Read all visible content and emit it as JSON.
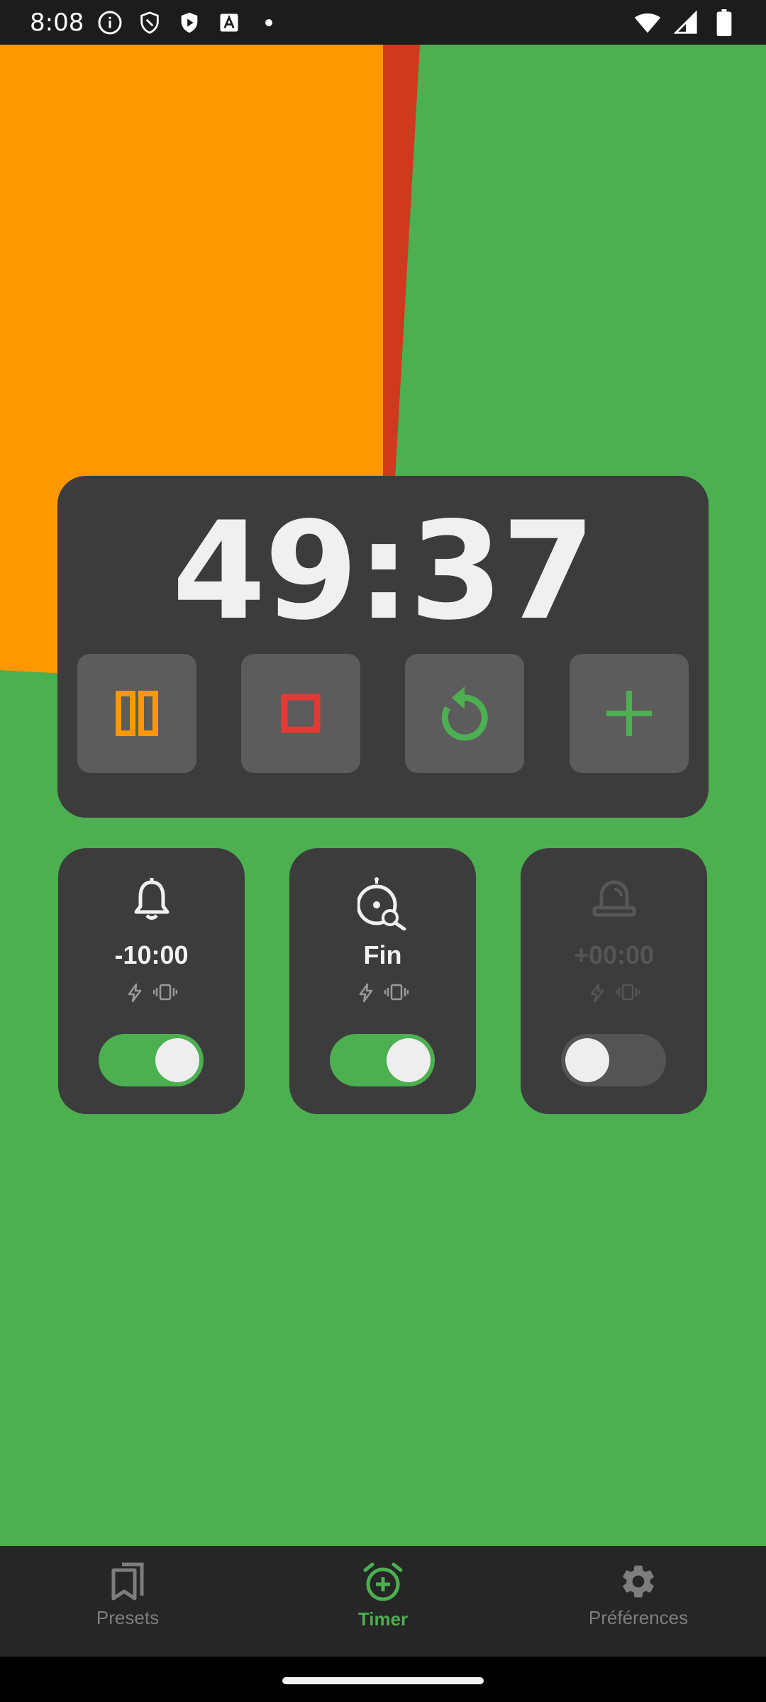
{
  "status_bar": {
    "time": "8:08",
    "icons": [
      "info-icon",
      "shield-icon",
      "play-store-icon",
      "font-icon",
      "dot-icon",
      "wifi-icon",
      "signal-icon",
      "battery-icon"
    ]
  },
  "timer": {
    "display": "49:37",
    "progress_colors": {
      "elapsed": "#ff9800",
      "current": "#cf3a1e",
      "remaining": "#4caf50"
    },
    "controls": [
      {
        "name": "pause",
        "icon": "pause-icon",
        "color": "#ff9800"
      },
      {
        "name": "stop",
        "icon": "stop-icon",
        "color": "#e53935"
      },
      {
        "name": "restart",
        "icon": "restart-icon",
        "color": "#4caf50"
      },
      {
        "name": "add-time",
        "icon": "plus-icon",
        "color": "#4caf50"
      }
    ]
  },
  "alarms": [
    {
      "label": "-10:00",
      "icon": "bell-icon",
      "enabled": true
    },
    {
      "label": "Fin",
      "icon": "alarm-end-icon",
      "enabled": true
    },
    {
      "label": "+00:00",
      "icon": "siren-icon",
      "enabled": false
    }
  ],
  "bottom_nav": {
    "items": [
      {
        "label": "Presets",
        "icon": "bookmarks-icon",
        "active": false
      },
      {
        "label": "Timer",
        "icon": "alarm-add-icon",
        "active": true
      },
      {
        "label": "Préférences",
        "icon": "gear-icon",
        "active": false
      }
    ],
    "active_color": "#4caf50"
  }
}
